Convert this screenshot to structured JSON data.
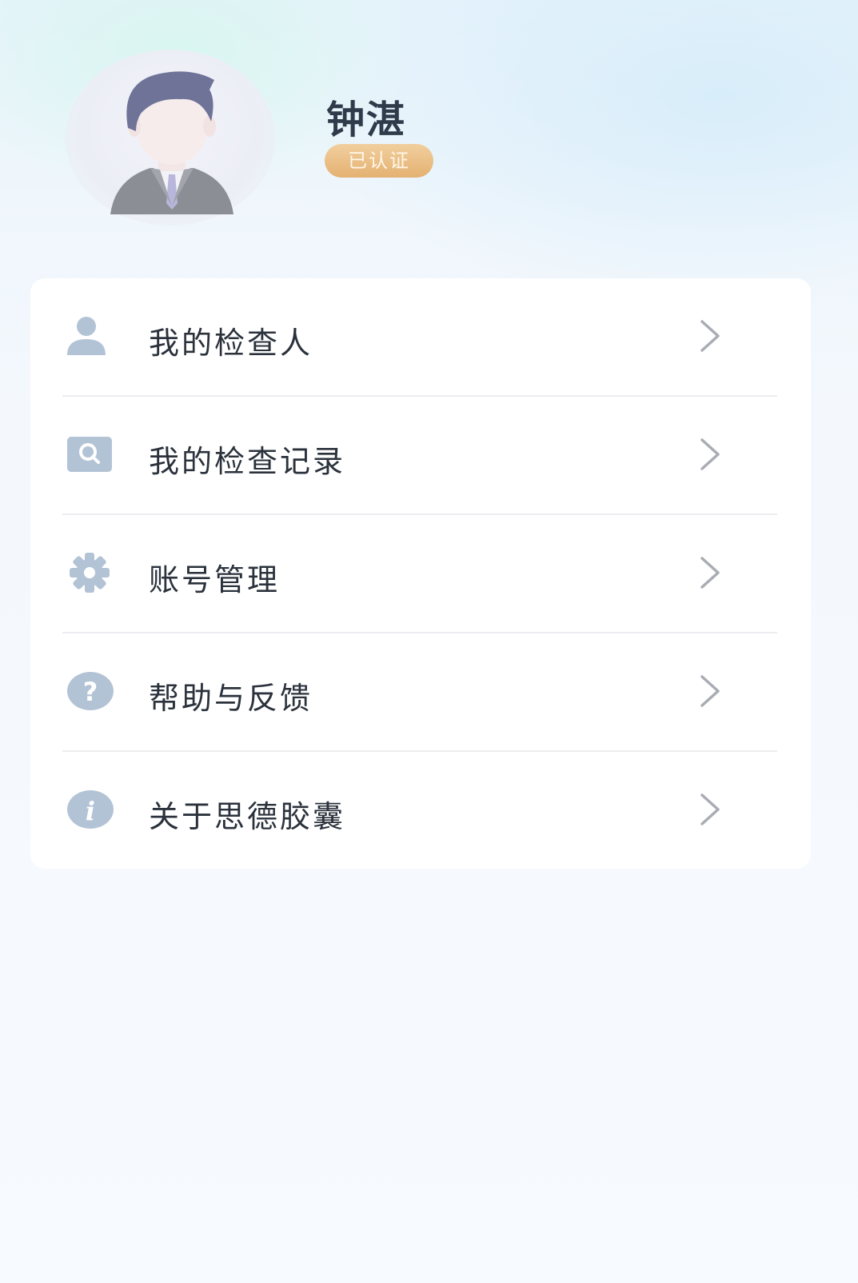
{
  "profile": {
    "name": "钟湛",
    "badge": "已认证"
  },
  "menu": {
    "items": [
      {
        "label": "我的检查人",
        "icon": "person-icon"
      },
      {
        "label": "我的检查记录",
        "icon": "search-record-icon"
      },
      {
        "label": "账号管理",
        "icon": "gear-icon"
      },
      {
        "label": "帮助与反馈",
        "icon": "question-icon"
      },
      {
        "label": "关于思德胶囊",
        "icon": "info-icon"
      }
    ]
  },
  "colors": {
    "icon": "#b3c3d6",
    "badge": "#e8b877",
    "chevron": "#a9adb3",
    "text": "#2b323c"
  }
}
